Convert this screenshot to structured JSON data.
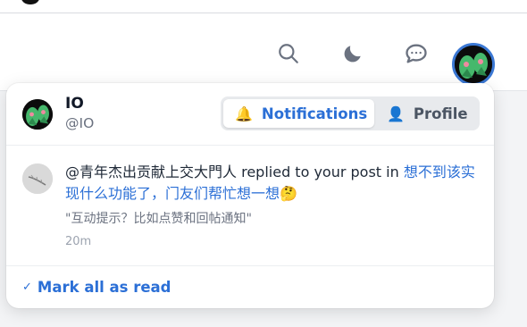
{
  "header": {
    "icons": [
      "search-icon",
      "moon-icon",
      "chat-icon"
    ],
    "colors": {
      "icon": "#6b7280",
      "accent": "#2b6fd6",
      "avatar_ring": "#3b78d4"
    }
  },
  "dropdown": {
    "user": {
      "name": "IO",
      "handle": "@IO"
    },
    "tabs": [
      {
        "label": "Notifications",
        "icon": "🔔",
        "active": true
      },
      {
        "label": "Profile",
        "icon": "👤",
        "active": false
      }
    ],
    "notification": {
      "actor": "@青年杰出贡献上交大門人",
      "action": " replied to your post in ",
      "topic": "想不到该实现什么功能了，门友们帮忙想一想",
      "emoji": "🤔",
      "quote": "\"互动提示？比如点赞和回帖通知\"",
      "time": "20m"
    },
    "footer": {
      "mark_all_label": "Mark all as read",
      "check": "✓"
    }
  }
}
